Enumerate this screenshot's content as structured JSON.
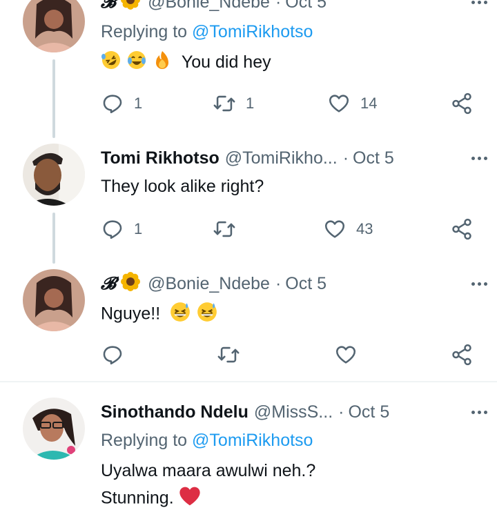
{
  "tweets": [
    {
      "prefix": "𝓑",
      "handle": "@Bonie_Ndebe",
      "date": "Oct 5",
      "replying_label": "Replying to",
      "replying_mention": "@TomiRikhotso",
      "text": "You did hey",
      "emojis": [
        "rofl-emoji",
        "joy-emoji",
        "fire-emoji"
      ],
      "replies": "1",
      "retweets": "1",
      "likes": "14"
    },
    {
      "name": "Tomi Rikhotso",
      "handle": "@TomiRikho...",
      "date": "Oct 5",
      "text": "They look alike right?",
      "replies": "1",
      "retweets": "",
      "likes": "43"
    },
    {
      "prefix": "𝓑",
      "handle": "@Bonie_Ndebe",
      "date": "Oct 5",
      "text": "Nguye!!",
      "emojis": [
        "sweat-smile-emoji",
        "sweat-smile-emoji"
      ],
      "replies": "",
      "retweets": "",
      "likes": ""
    },
    {
      "name": "Sinothando Ndelu",
      "handle": "@MissS...",
      "date": "Oct 5",
      "replying_label": "Replying to",
      "replying_mention": "@TomiRikhotso",
      "text_line1": "Uyalwa maara awulwi neh.?",
      "text_line2": "Stunning.",
      "emojis": [
        "red-heart-emoji"
      ]
    }
  ],
  "separator": "·",
  "colors": {
    "accent": "#1d9bf0",
    "secondary_text": "#536471",
    "thread_line": "#cfd9de",
    "heart": "#e0245e"
  }
}
